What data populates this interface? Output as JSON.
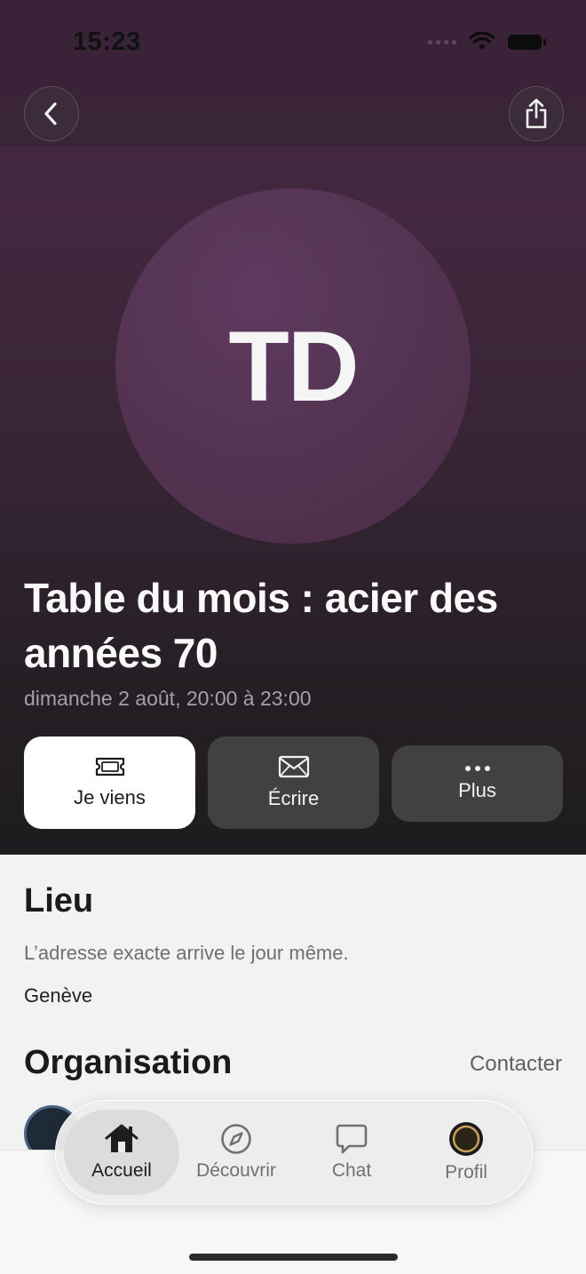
{
  "status_bar": {
    "time": "15:23"
  },
  "nav": {
    "back_icon": "chevron-left-icon",
    "share_icon": "share-icon"
  },
  "event": {
    "initials": "TD",
    "title": "Table du mois : acier des années 70",
    "datetime": "dimanche 2 août, 20:00 à 23:00"
  },
  "actions": {
    "attend": {
      "label": "Je viens",
      "icon": "ticket-icon"
    },
    "write": {
      "label": "Écrire",
      "icon": "envelope-icon"
    },
    "more": {
      "label": "Plus",
      "icon": "more-dots-icon"
    }
  },
  "location": {
    "title": "Lieu",
    "note": "L’adresse exacte arrive le jour même.",
    "city": "Genève"
  },
  "organisation": {
    "title": "Organisation",
    "contact_label": "Contacter"
  },
  "tabbar": {
    "items": [
      {
        "label": "Accueil",
        "icon": "home-icon",
        "active": true
      },
      {
        "label": "Découvrir",
        "icon": "compass-icon",
        "active": false
      },
      {
        "label": "Chat",
        "icon": "chat-bubble-icon",
        "active": false
      },
      {
        "label": "Profil",
        "icon": "profile-avatar-icon",
        "active": false
      }
    ]
  },
  "colors": {
    "hero_top": "#3f2540",
    "hero_bottom": "#1e1c1f",
    "avatar": "#52324f",
    "page_bg": "#f2f2f2"
  }
}
